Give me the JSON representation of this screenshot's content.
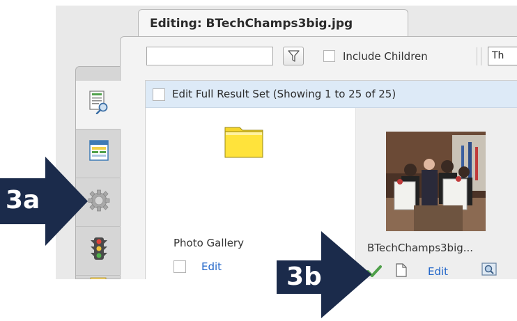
{
  "tab": {
    "title": "Editing: BTechChamps3big.jpg"
  },
  "toolbar": {
    "search_value": "",
    "include_children_label": "Include Children",
    "view_select_value": "Th"
  },
  "result_bar": {
    "label": "Edit Full Result Set (Showing 1 to 25 of 25)"
  },
  "items": [
    {
      "name": "Photo Gallery",
      "edit_label": "Edit",
      "icon": "folder-icon"
    },
    {
      "name": "BTechChamps3big...",
      "edit_label": "Edit",
      "icon": "photo-thumbnail"
    }
  ],
  "sidebar": {
    "items": [
      {
        "icon": "document-search-icon"
      },
      {
        "icon": "form-icon"
      },
      {
        "icon": "gear-icon"
      },
      {
        "icon": "traffic-light-icon"
      },
      {
        "icon": "note-icon"
      }
    ]
  },
  "callouts": {
    "a": {
      "label": "3a"
    },
    "b": {
      "label": "3b"
    }
  },
  "colors": {
    "arrow": "#1b2b4b",
    "link": "#1f64c8",
    "result_bar": "#ddeaf7"
  }
}
